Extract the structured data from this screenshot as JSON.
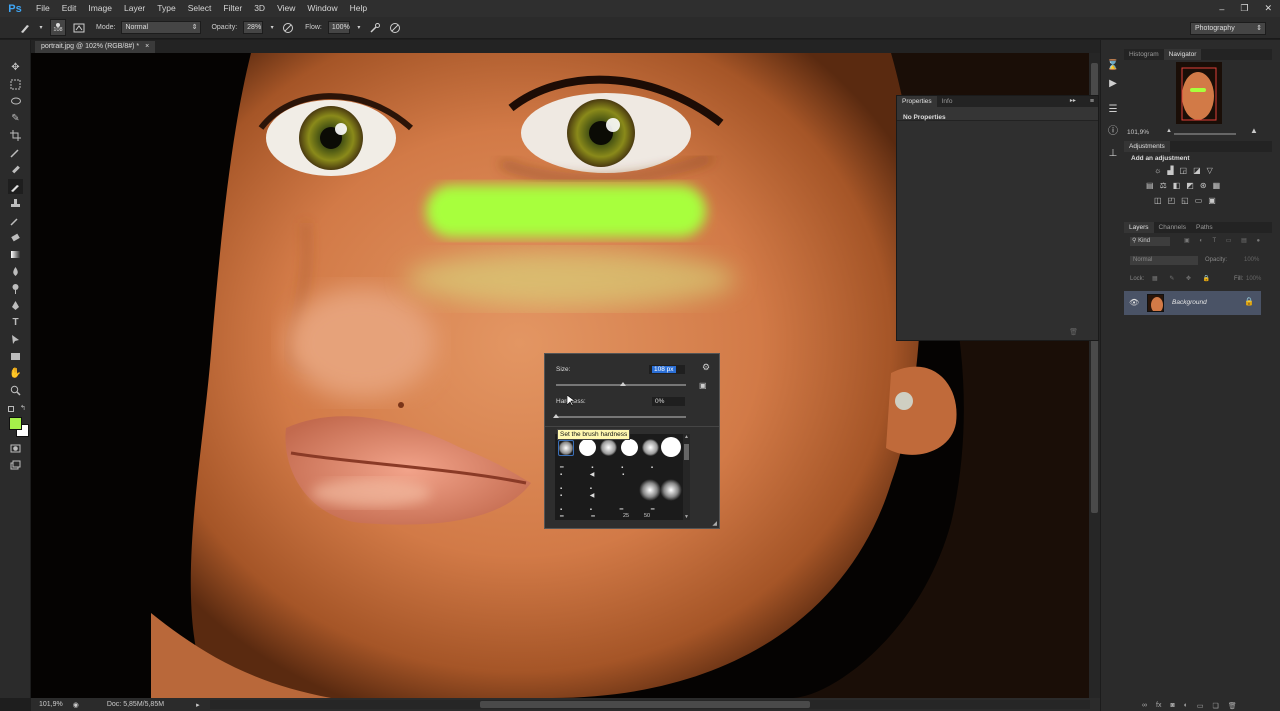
{
  "app": {
    "logo": "Ps"
  },
  "menu": [
    "File",
    "Edit",
    "Image",
    "Layer",
    "Type",
    "Select",
    "Filter",
    "3D",
    "View",
    "Window",
    "Help"
  ],
  "window_controls": [
    "–",
    "❐",
    "✕"
  ],
  "options_bar": {
    "brush_size": "108",
    "mode_label": "Mode:",
    "mode_value": "Normal",
    "opacity_label": "Opacity:",
    "opacity_value": "28%",
    "flow_label": "Flow:",
    "flow_value": "100%"
  },
  "workspace": "Photography",
  "document": {
    "tab_label": "portrait.jpg @ 102% (RGB/8#) *",
    "close": "×"
  },
  "status": {
    "zoom": "101,9%",
    "doc_size": "Doc: 5,85M/5,85M"
  },
  "navigator": {
    "tabs": [
      "Histogram",
      "Navigator"
    ],
    "zoom": "101,9%"
  },
  "adjustments": {
    "title": "Adjustments",
    "subtitle": "Add an adjustment"
  },
  "layers": {
    "tabs": [
      "Layers",
      "Channels",
      "Paths"
    ],
    "kind": "Kind",
    "blend_mode": "Normal",
    "opacity_label": "Opacity:",
    "opacity_value": "100%",
    "lock_label": "Lock:",
    "fill_label": "Fill:",
    "fill_value": "100%",
    "layer_name": "Background"
  },
  "properties_panel": {
    "tabs": [
      "Properties",
      "Info"
    ],
    "message": "No Properties"
  },
  "brush_picker": {
    "size_label": "Size:",
    "size_value": "108 px",
    "hardness_label": "Hardness:",
    "hardness_value": "0%",
    "tooltip": "Set the brush hardness",
    "grid_labels": [
      "25",
      "50"
    ]
  },
  "colors": {
    "foreground": "#a6f04a",
    "background": "#ffffff",
    "accent": "#3fa6f5",
    "stroke": "#a8ff3c"
  }
}
